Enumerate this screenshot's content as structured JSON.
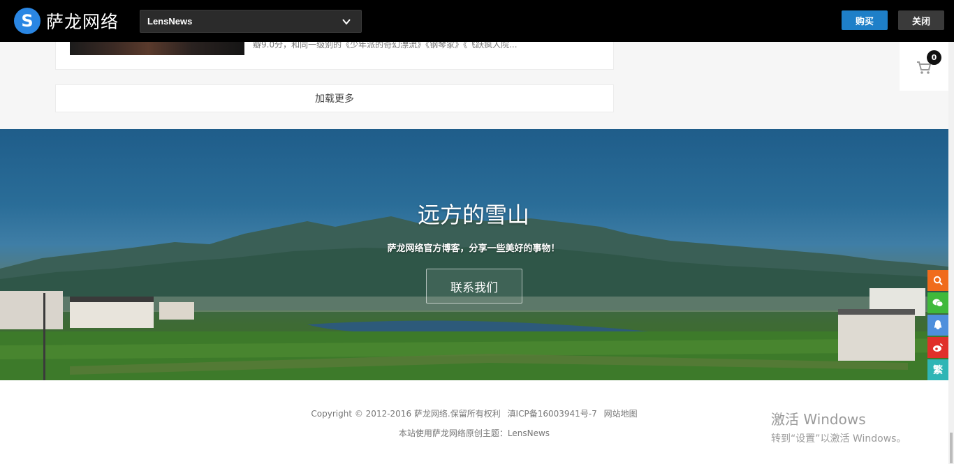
{
  "topbar": {
    "logo_badge": "S",
    "logo_text": "萨龙网络",
    "theme_selected": "LensNews",
    "buy_label": "购买",
    "close_label": "关闭"
  },
  "post": {
    "excerpt": "瓣9.0分，和同一级别的《少年派的奇幻漂流》《钢琴家》《飞跃疯人院..."
  },
  "load_more_label": "加载更多",
  "cart": {
    "count": "0"
  },
  "banner": {
    "title": "远方的雪山",
    "subtitle": "萨龙网络官方博客，分享一些美好的事物！",
    "button_label": "联系我们"
  },
  "side": {
    "traditional_label": "繁"
  },
  "footer": {
    "copyright": "Copyright © 2012-2016 萨龙网络.保留所有权利",
    "icp": "滇ICP备16003941号-7",
    "sitemap": "网站地图",
    "theme_note": "本站使用萨龙网络原创主题：LensNews"
  },
  "watermark": {
    "title": "激活 Windows",
    "subtitle": "转到“设置”以激活 Windows。"
  },
  "colors": {
    "buy": "#1e7fc8",
    "search": "#f06b1c",
    "wechat": "#3fb93b",
    "qq": "#4e8fdc",
    "weibo": "#e0302a",
    "traditional": "#2fb5b5"
  }
}
